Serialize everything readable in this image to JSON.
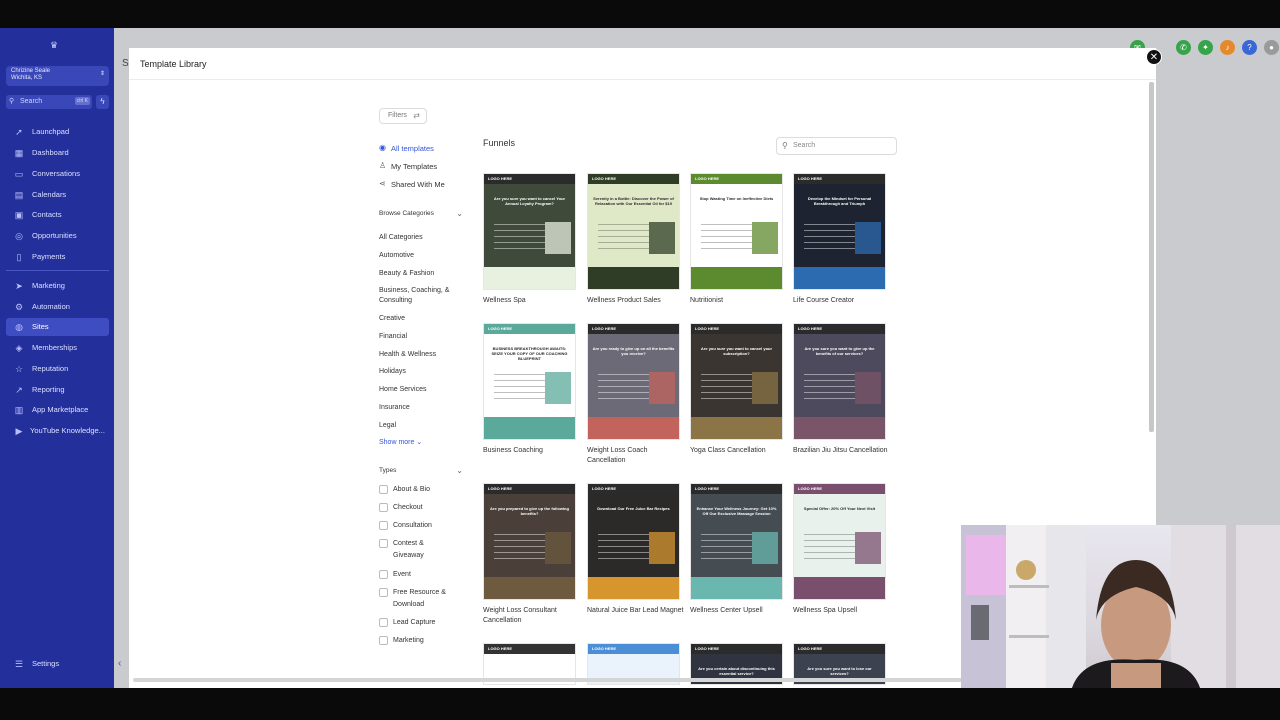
{
  "sidebar": {
    "account_name": "Chrizine Seale",
    "account_location": "Wichita, KS",
    "search_placeholder": "Search",
    "search_shortcut": "ctrl K",
    "nav": [
      {
        "label": "Launchpad",
        "icon": "rocket-icon"
      },
      {
        "label": "Dashboard",
        "icon": "dashboard-icon"
      },
      {
        "label": "Conversations",
        "icon": "chat-icon"
      },
      {
        "label": "Calendars",
        "icon": "calendar-icon"
      },
      {
        "label": "Contacts",
        "icon": "contacts-icon"
      },
      {
        "label": "Opportunities",
        "icon": "target-icon"
      },
      {
        "label": "Payments",
        "icon": "payments-icon"
      },
      {
        "label": "Marketing",
        "icon": "megaphone-icon"
      },
      {
        "label": "Automation",
        "icon": "automation-icon"
      },
      {
        "label": "Sites",
        "icon": "globe-icon"
      },
      {
        "label": "Memberships",
        "icon": "membership-icon"
      },
      {
        "label": "Reputation",
        "icon": "star-icon"
      },
      {
        "label": "Reporting",
        "icon": "reporting-icon"
      },
      {
        "label": "App Marketplace",
        "icon": "marketplace-icon"
      },
      {
        "label": "YouTube Knowledge...",
        "icon": "youtube-icon"
      }
    ],
    "active_item": "Sites",
    "settings_label": "Settings"
  },
  "background_letter": "S",
  "modal": {
    "title": "Template Library",
    "filters_label": "Filters",
    "library_links": [
      {
        "label": "All templates",
        "icon": "check-circle-icon",
        "active": true
      },
      {
        "label": "My Templates",
        "icon": "user-icon",
        "active": false
      },
      {
        "label": "Shared With Me",
        "icon": "share-icon",
        "active": false
      }
    ],
    "browse_categories_label": "Browse Categories",
    "categories": [
      "All Categories",
      "Automotive",
      "Beauty & Fashion",
      "Business, Coaching, & Consulting",
      "Creative",
      "Financial",
      "Health & Wellness",
      "Holidays",
      "Home Services",
      "Insurance",
      "Legal"
    ],
    "show_more_label": "Show more",
    "types_label": "Types",
    "types": [
      "About & Bio",
      "Checkout",
      "Consultation",
      "Contest & Giveaway",
      "Event",
      "Free Resource & Download",
      "Lead Capture",
      "Marketing"
    ],
    "section_title": "Funnels",
    "search_placeholder": "Search",
    "templates": [
      {
        "name": "Wellness Spa",
        "bg": "#3f4a3a",
        "accent": "#e8f0e0",
        "thumb_text": "Are you sure you want to cancel Your Annual Loyalty Program?"
      },
      {
        "name": "Wellness Product Sales",
        "bg": "#dfe9c8",
        "accent": "#2f3d26",
        "thumb_text": "Serenity in a Bottle: Discover the Power of Relaxation with Our Essential Oil for $19"
      },
      {
        "name": "Nutritionist",
        "bg": "#ffffff",
        "accent": "#5c8a2e",
        "thumb_text": "Stop Wasting Time on Ineffective Diets"
      },
      {
        "name": "Life Course Creator",
        "bg": "#1d2330",
        "accent": "#2d6bb0",
        "thumb_text": "Develop the Mindset for Personal Breakthrough and Triumph"
      },
      {
        "name": "Business Coaching",
        "bg": "#ffffff",
        "accent": "#5aa99a",
        "thumb_text": "BUSINESS BREAKTHROUGH AWAITS: SEIZE YOUR COPY OF OUR COACHING BLUEPRINT"
      },
      {
        "name": "Weight Loss Coach Cancellation",
        "bg": "#6d6a78",
        "accent": "#c2645c",
        "thumb_text": "Are you ready to give up on all the benefits you receive?"
      },
      {
        "name": "Yoga Class Cancellation",
        "bg": "#3b3531",
        "accent": "#8b7446",
        "thumb_text": "Are you sure you want to cancel your subscription?"
      },
      {
        "name": "Brazilian Jiu Jitsu Cancellation",
        "bg": "#4d4a5e",
        "accent": "#7a5468",
        "thumb_text": "Are you sure you want to give up the benefits of our services?"
      },
      {
        "name": "Weight Loss Consultant Cancellation",
        "bg": "#4a4039",
        "accent": "#6e5a3e",
        "thumb_text": "Are you prepared to give up the following benefits?"
      },
      {
        "name": "Natural Juice Bar Lead Magnet",
        "bg": "#2c2a28",
        "accent": "#d7952e",
        "thumb_text": "Download Our Free Juice Bar Recipes"
      },
      {
        "name": "Wellness Center Upsell",
        "bg": "#454c52",
        "accent": "#6ab7b0",
        "thumb_text": "Enhance Your Wellness Journey: Get 10% Off Our Exclusive Massage Session"
      },
      {
        "name": "Wellness Spa Upsell",
        "bg": "#e8f1ec",
        "accent": "#7a4f6e",
        "thumb_text": "Special Offer: 20% Off Your Next Visit"
      },
      {
        "name": "",
        "bg": "#ffffff",
        "accent": "#333333",
        "thumb_text": ""
      },
      {
        "name": "",
        "bg": "#eaf3fb",
        "accent": "#4a8fd6",
        "thumb_text": ""
      },
      {
        "name": "",
        "bg": "#2f3440",
        "accent": "#333333",
        "thumb_text": "Are you certain about discontinuing this essential service?"
      },
      {
        "name": "",
        "bg": "#3d4250",
        "accent": "#4d4a5e",
        "thumb_text": "Are you sure you want to lose our services?"
      }
    ],
    "logo_text": "LOGO HERE"
  },
  "colors": {
    "sidebar_bg": "#232f9a",
    "accent_blue": "#3355dd"
  }
}
